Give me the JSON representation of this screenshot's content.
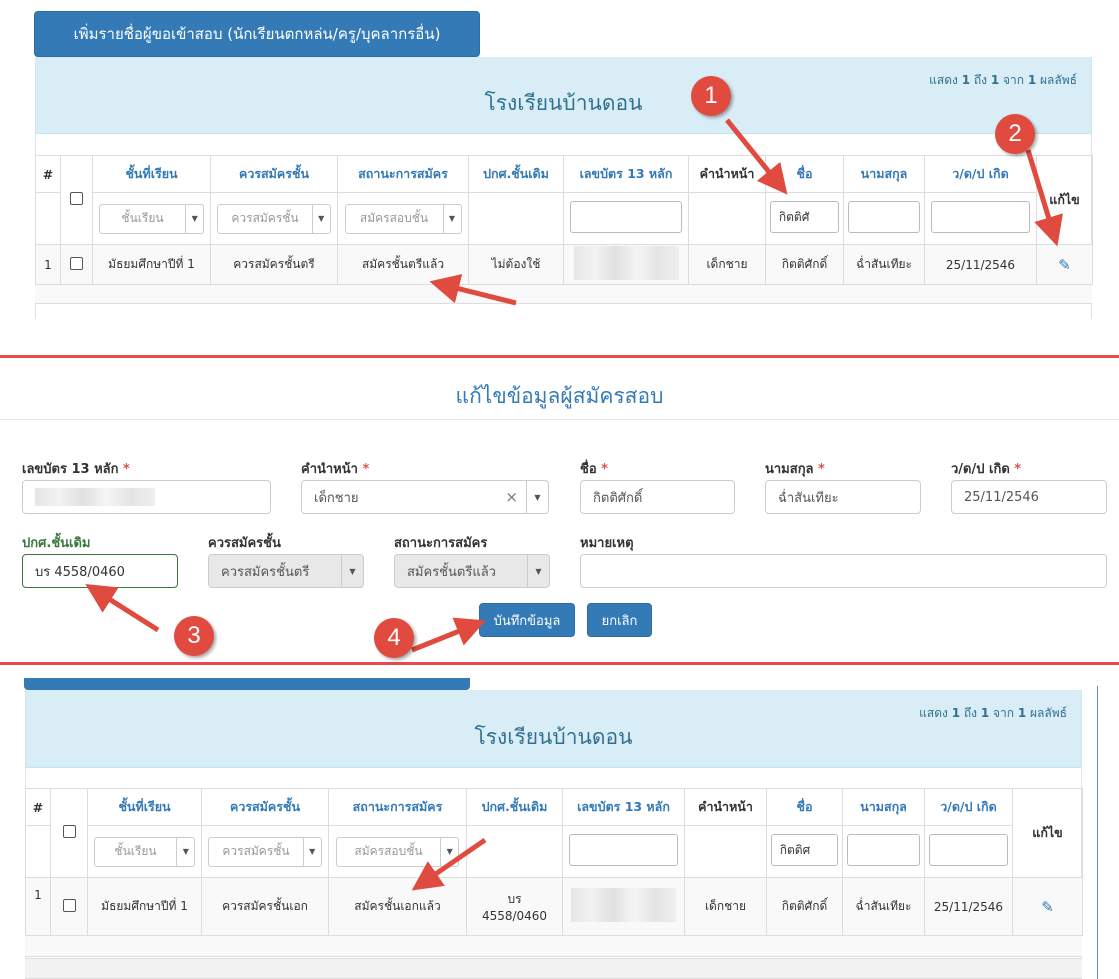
{
  "top": {
    "add_button": "เพิ่มรายชื่อผู้ขอเข้าสอบ (นักเรียนตกหล่น/ครู/บุคลากรอื่น)",
    "school_name": "โรงเรียนบ้านดอน",
    "info_prefix": "แสดง ",
    "info_from": "1",
    "info_mid1": " ถึง ",
    "info_to": "1",
    "info_mid2": " จาก ",
    "info_total": "1",
    "info_suffix": " ผลลัพธ์"
  },
  "table": {
    "headers": [
      "#",
      "ชั้นที่เรียน",
      "ควรสมัครชั้น",
      "สถานะการสมัคร",
      "ปกศ.ชั้นเดิม",
      "เลขบัตร 13 หลัก",
      "คำนำหน้า",
      "ชื่อ",
      "นามสกุล",
      "ว/ด/ป เกิด",
      "แก้ไข"
    ],
    "filters": {
      "level_placeholder": "ชั้นเรียน",
      "apply_placeholder": "ควรสมัครชั้น",
      "status_placeholder": "สมัครสอบชั้น",
      "name_value_top": "กิตติศั",
      "name_value_bottom": "กิตติศ"
    }
  },
  "row_before": {
    "num": "1",
    "level": "มัธยมศึกษาปีที่ 1",
    "apply": "ควรสมัครชั้นตรี",
    "status": "สมัครชั้นตรีแล้ว",
    "cert": "ไม่ต้องใช้",
    "prefix": "เด็กชาย",
    "first": "กิตติศักดิ์",
    "last": "ฉ่ำสันเทียะ",
    "dob": "25/11/2546"
  },
  "form": {
    "title": "แก้ไขข้อมูลผู้สมัครสอบ",
    "id_label": "เลขบัตร 13 หลัก",
    "prefix_label": "คำนำหน้า",
    "first_label": "ชื่อ",
    "last_label": "นามสกุล",
    "dob_label": "ว/ด/ป เกิด",
    "required_mark": " *",
    "prefix_value": "เด็กชาย",
    "clear_glyph": "×",
    "first_value": "กิตติศักดิ์",
    "last_value": "ฉ่ำสันเทียะ",
    "dob_value": "25/11/2546",
    "cert_label": "ปกศ.ชั้นเดิม",
    "cert_value": "บร 4558/0460",
    "apply_label": "ควรสมัครชั้น",
    "apply_value": "ควรสมัครชั้นตรี",
    "status_label": "สถานะการสมัคร",
    "status_value": "สมัครชั้นตรีแล้ว",
    "note_label": "หมายเหตุ",
    "save_button": "บันทึกข้อมูล",
    "cancel_button": "ยกเลิก"
  },
  "row_after": {
    "num": "1",
    "level": "มัธยมศึกษาปีที่ 1",
    "apply": "ควรสมัครชั้นเอก",
    "status": "สมัครชั้นเอกแล้ว",
    "cert_line1": "บร",
    "cert_line2": "4558/0460",
    "prefix": "เด็กชาย",
    "first": "กิตติศักดิ์",
    "last": "ฉ่ำสันเทียะ",
    "dob": "25/11/2546"
  },
  "callouts": [
    "1",
    "2",
    "3",
    "4"
  ],
  "colors": {
    "primary": "#337ab7",
    "panel_heading": "#d9edf7",
    "callout_red": "#e04a3f",
    "divider_red": "#e54b4b",
    "valid_green": "#3c763d"
  },
  "icons": {
    "edit": "pencil-icon",
    "dropdown": "chevron-down-icon",
    "clear": "close-icon"
  }
}
